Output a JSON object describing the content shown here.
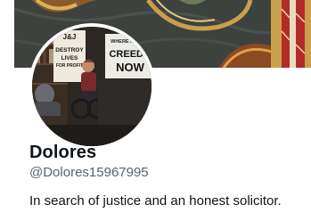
{
  "profile": {
    "display_name": "Dolores",
    "handle": "@Dolores15967995",
    "bio": "In search of justice and an honest solicitor."
  },
  "avatar_sign": {
    "jj": "J&J",
    "destroy_lines": [
      "DESTROY",
      "LIVES",
      "FOR PROFIT"
    ],
    "right_lines": [
      "WHERE IS THE",
      "CREEDO",
      "NOW"
    ]
  },
  "colors": {
    "name_text": "#0f1419",
    "handle_text": "#536471",
    "banner_fabric": "#3a3f3c",
    "banner_gold": "#c9a04b",
    "banner_red": "#b42a2a"
  }
}
